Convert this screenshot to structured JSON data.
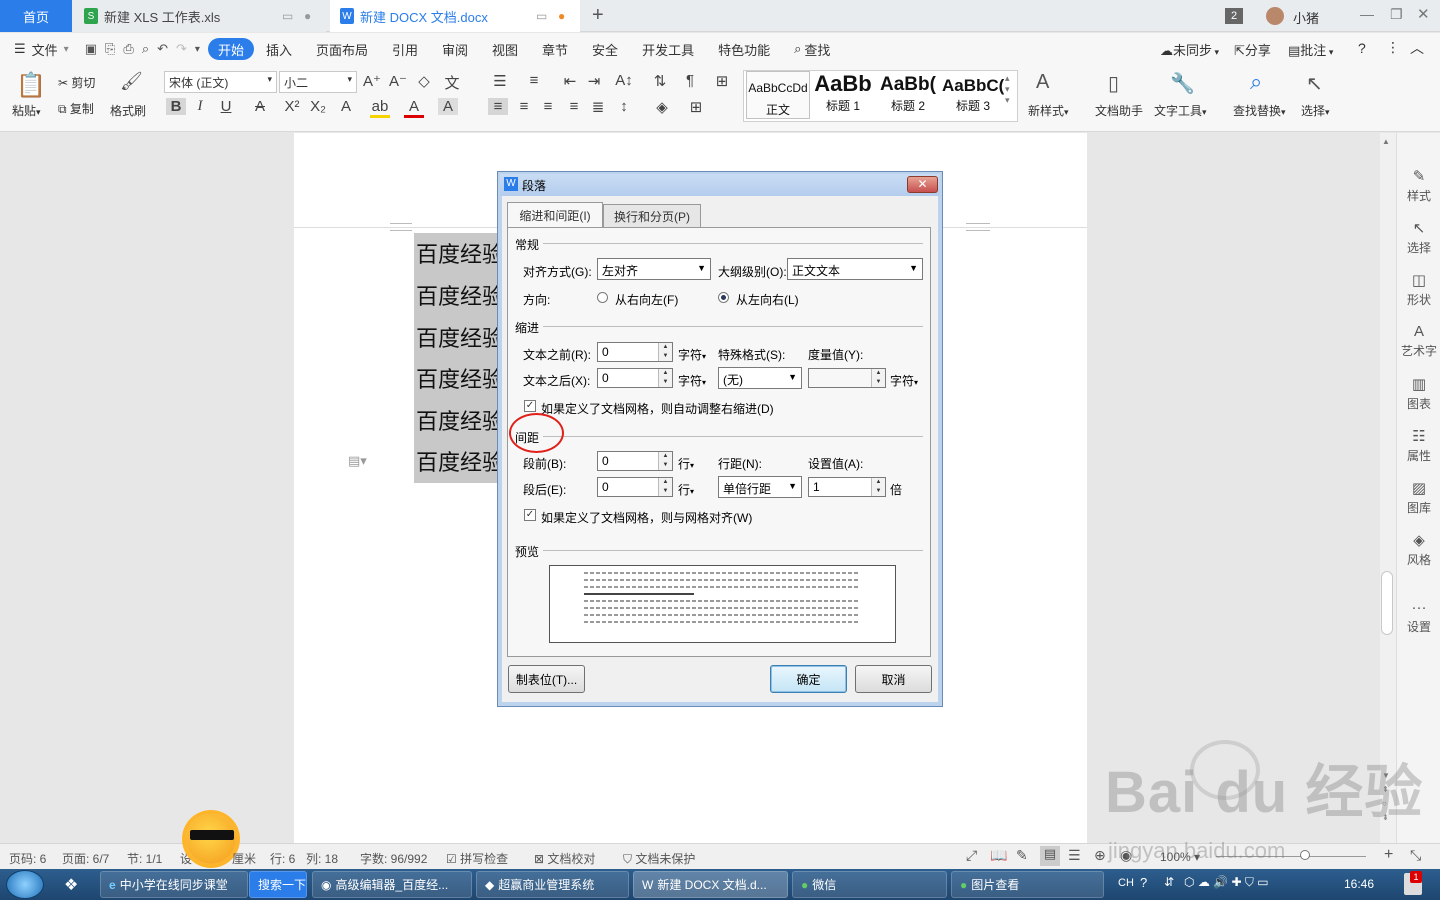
{
  "tabs": {
    "home": "首页",
    "xls": "新建 XLS 工作表.xls",
    "docx": "新建 DOCX 文档.docx",
    "new_tab": "+",
    "badge": "2",
    "user": "小猪"
  },
  "menu": {
    "file": "文件",
    "items": [
      "开始",
      "插入",
      "页面布局",
      "引用",
      "审阅",
      "视图",
      "章节",
      "安全",
      "开发工具",
      "特色功能"
    ],
    "search": "查找",
    "sync": "未同步",
    "share": "分享",
    "comment": "批注"
  },
  "ribbon": {
    "paste": "粘贴",
    "cut": "剪切",
    "copy": "复制",
    "format_painter": "格式刷",
    "font_name": "宋体 (正文)",
    "font_size": "小二",
    "styles": [
      {
        "sample": "AaBbCcDd",
        "label": "正文"
      },
      {
        "sample": "AaBb",
        "label": "标题 1"
      },
      {
        "sample": "AaBb(",
        "label": "标题 2"
      },
      {
        "sample": "AaBbC(",
        "label": "标题 3"
      }
    ],
    "new_style": "新样式",
    "doc_helper": "文档助手",
    "text_tool": "文字工具",
    "find_replace": "查找替换",
    "select": "选择"
  },
  "document": {
    "lines": [
      "百度经验",
      "百度经验",
      "百度经验",
      "百度经验",
      "百度经验",
      "百度经验"
    ]
  },
  "sidebar": {
    "items": [
      "样式",
      "选择",
      "形状",
      "艺术字",
      "图表",
      "属性",
      "图库",
      "风格",
      "设置"
    ]
  },
  "dialog": {
    "title": "段落",
    "tab_indent": "缩进和间距(I)",
    "tab_break": "换行和分页(P)",
    "sec_general": "常规",
    "align_label": "对齐方式(G):",
    "align_value": "左对齐",
    "outline_label": "大纲级别(O):",
    "outline_value": "正文文本",
    "direction_label": "方向:",
    "rtl": "从右向左(F)",
    "ltr": "从左向右(L)",
    "sec_indent": "缩进",
    "before_text_label": "文本之前(R):",
    "before_text_value": "0",
    "after_text_label": "文本之后(X):",
    "after_text_value": "0",
    "unit_char": "字符",
    "special_label": "特殊格式(S):",
    "special_value": "(无)",
    "measure_label": "度量值(Y):",
    "auto_indent": "如果定义了文档网格，则自动调整右缩进(D)",
    "sec_spacing": "间距",
    "space_before_label": "段前(B):",
    "space_before_value": "0",
    "space_after_label": "段后(E):",
    "space_after_value": "0",
    "unit_line": "行",
    "line_spacing_label": "行距(N):",
    "line_spacing_value": "单倍行距",
    "setting_label": "设置值(A):",
    "setting_value": "1",
    "unit_times": "倍",
    "snap_grid": "如果定义了文档网格，则与网格对齐(W)",
    "sec_preview": "预览",
    "tabs_btn": "制表位(T)...",
    "ok": "确定",
    "cancel": "取消"
  },
  "status": {
    "page_num": "页码: 6",
    "pages": "页面: 6/7",
    "section": "节: 1/1",
    "setting": "设",
    "unit": "厘米",
    "row": "行: 6",
    "col": "列: 18",
    "words": "字数: 96/992",
    "spell": "拼写检查",
    "proof": "文档校对",
    "protect": "文档未保护",
    "zoom": "100%"
  },
  "taskbar": {
    "items": [
      "中小学在线同步课堂",
      "搜索一下",
      "高级编辑器_百度经...",
      "超赢商业管理系统",
      "新建 DOCX 文档.d...",
      "微信",
      "图片查看"
    ],
    "lang": "CH",
    "time": "16:46",
    "notify": "1"
  },
  "watermark": "Bai du 经验",
  "watermark_url": "jingyan.baidu.com"
}
